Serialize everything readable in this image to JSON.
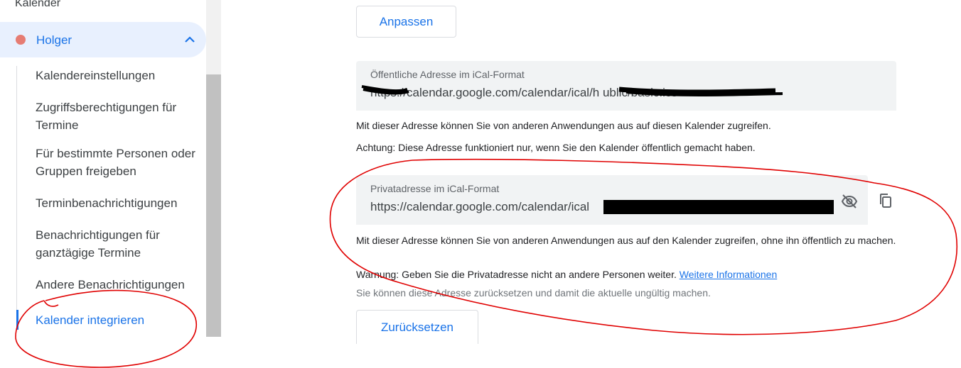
{
  "sidebar": {
    "heading": "Kalender",
    "calendar": {
      "name": "Holger",
      "color": "#e67c73"
    },
    "items": [
      {
        "label": "Kalendereinstellungen"
      },
      {
        "label": "Zugriffsberechtigungen für Termine"
      },
      {
        "label": "Für bestimmte Personen oder Gruppen freigeben"
      },
      {
        "label": "Terminbenachrichtigungen"
      },
      {
        "label": "Benachrichtigungen für ganztägige Termine"
      },
      {
        "label": "Andere Benachrichtigungen"
      },
      {
        "label": "Kalender integrieren",
        "active": true
      }
    ]
  },
  "main": {
    "customize_button": "Anpassen",
    "public_address": {
      "label": "Öffentliche Adresse im iCal-Format",
      "value": "https://calendar.google.com/calendar/ical/h                    ublic/basic.ics"
    },
    "public_help": "Mit dieser Adresse können Sie von anderen Anwendungen aus auf diesen Kalender zugreifen.",
    "public_warning": "Achtung: Diese Adresse funktioniert nur, wenn Sie den Kalender öffentlich gemacht haben.",
    "private_address": {
      "label": "Privatadresse im iCal-Format",
      "value": "https://calendar.google.com/calendar/ical"
    },
    "private_help": "Mit dieser Adresse können Sie von anderen Anwendungen aus auf den Kalender zugreifen, ohne ihn öffentlich zu machen.",
    "private_warning": "Warnung: Geben Sie die Privatadresse nicht an andere Personen weiter.",
    "more_info_link": "Weitere Informationen",
    "reset_note": "Sie können diese Adresse zurücksetzen und damit die aktuelle ungültig machen.",
    "reset_button": "Zurücksetzen"
  },
  "colors": {
    "accent": "#1a73e8",
    "annotation": "#e00000",
    "field_bg": "#f1f3f4"
  },
  "icons": {
    "expand": "chevron-up-icon",
    "visibility": "eye-off-icon",
    "copy": "copy-icon"
  }
}
